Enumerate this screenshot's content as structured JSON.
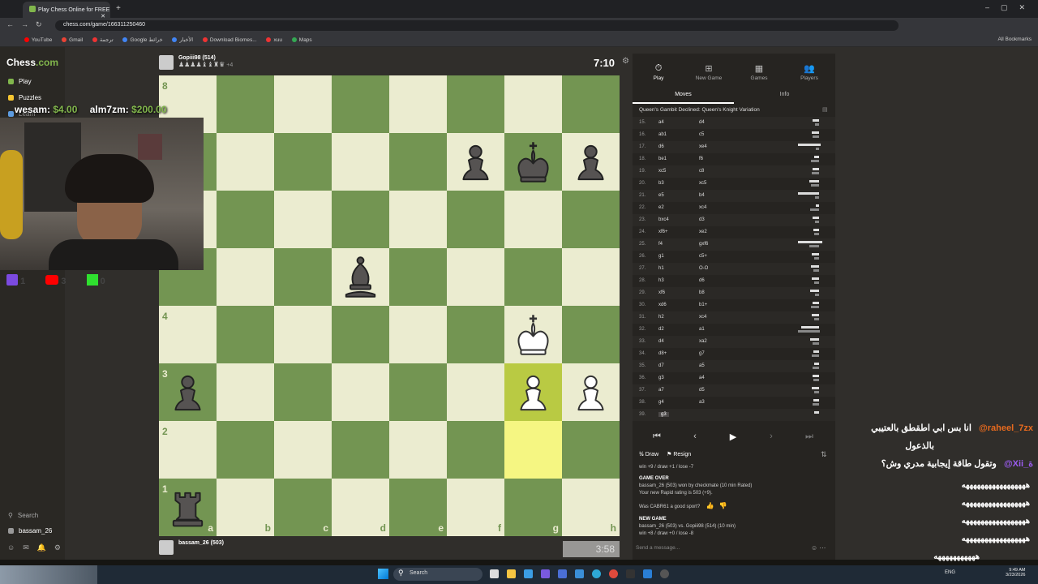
{
  "browser": {
    "tab_title": "Play Chess Online for FREE",
    "url": "chess.com/game/166311250460",
    "bookmarks": [
      "YouTube",
      "Gmail",
      "ترجمة",
      "Google خرائط",
      "الأخبار",
      "Download Biomes...",
      "xuu",
      "Maps"
    ],
    "all_bookmarks": "All Bookmarks"
  },
  "sidebar": {
    "logo_part1": "Chess",
    "logo_part2": ".com",
    "items": [
      "Play",
      "Puzzles",
      "Learn"
    ],
    "search": "Search",
    "user": "bassam_26"
  },
  "top_player": {
    "name": "Gopiii98 (514)",
    "captured": "♟♟♟♟♝♝♜♛",
    "adv": "+4",
    "clock": "7:10"
  },
  "bottom_player": {
    "name": "bassam_26 (503)",
    "clock": "3:58"
  },
  "board": {
    "ranks": [
      "8",
      "7",
      "6",
      "5",
      "4",
      "3",
      "2",
      "1"
    ],
    "files": [
      "a",
      "b",
      "c",
      "d",
      "e",
      "f",
      "g",
      "h"
    ],
    "pieces": [
      {
        "sq": "f7",
        "p": "bP"
      },
      {
        "sq": "g7",
        "p": "bK"
      },
      {
        "sq": "h7",
        "p": "bP"
      },
      {
        "sq": "d5",
        "p": "bB"
      },
      {
        "sq": "g4",
        "p": "wK"
      },
      {
        "sq": "a3",
        "p": "bP"
      },
      {
        "sq": "g3",
        "p": "wP"
      },
      {
        "sq": "h3",
        "p": "wP"
      },
      {
        "sq": "a1",
        "p": "bR"
      }
    ],
    "highlight": [
      "g3",
      "g2"
    ]
  },
  "panel": {
    "tabs": [
      "Play",
      "New Game",
      "Games",
      "Players"
    ],
    "subtabs": [
      "Moves",
      "Info"
    ],
    "opening": "Queen's Gambit Declined: Queen's Knight Variation",
    "moves": [
      {
        "n": "15.",
        "w": "a4",
        "b": "d4"
      },
      {
        "n": "16.",
        "w": "ab1",
        "b": "c5"
      },
      {
        "n": "17.",
        "w": "d6",
        "b": "xe4"
      },
      {
        "n": "18.",
        "w": "be1",
        "b": "f6"
      },
      {
        "n": "19.",
        "w": "xc5",
        "b": "c8"
      },
      {
        "n": "20.",
        "w": "b3",
        "b": "xc5"
      },
      {
        "n": "21.",
        "w": "e5",
        "b": "b4"
      },
      {
        "n": "22.",
        "w": "e2",
        "b": "xc4"
      },
      {
        "n": "23.",
        "w": "bxc4",
        "b": "d3"
      },
      {
        "n": "24.",
        "w": "xf6+",
        "b": "xe2"
      },
      {
        "n": "25.",
        "w": "f4",
        "b": "gxf6"
      },
      {
        "n": "26.",
        "w": "g1",
        "b": "c5+"
      },
      {
        "n": "27.",
        "w": "h1",
        "b": "O-O"
      },
      {
        "n": "28.",
        "w": "h3",
        "b": "d6"
      },
      {
        "n": "29.",
        "w": "xf6",
        "b": "b8"
      },
      {
        "n": "30.",
        "w": "xd6",
        "b": "b1+"
      },
      {
        "n": "31.",
        "w": "h2",
        "b": "xc4"
      },
      {
        "n": "32.",
        "w": "d2",
        "b": "a1"
      },
      {
        "n": "33.",
        "w": "d4",
        "b": "xa2"
      },
      {
        "n": "34.",
        "w": "d8+",
        "b": "g7"
      },
      {
        "n": "35.",
        "w": "d7",
        "b": "a5"
      },
      {
        "n": "36.",
        "w": "g3",
        "b": "a4"
      },
      {
        "n": "37.",
        "w": "a7",
        "b": "d5"
      },
      {
        "n": "38.",
        "w": "g4",
        "b": "a3"
      },
      {
        "n": "39.",
        "w": "g3",
        "b": ""
      }
    ],
    "draw": "Draw",
    "resign": "Resign",
    "record": "win +9 / draw +1 / lose -7",
    "game_over_title": "GAME OVER",
    "game_over_line1": "bassam_26 (503) won by checkmate (10 min Rated)",
    "game_over_line2": "Your new Rapid rating is 503 (+9).",
    "sport_q": "Was CABR61 a good sport?",
    "new_game_title": "NEW GAME",
    "new_game_line1": "bassam_26 (503) vs. Gopiii98 (514) (10 min)",
    "new_game_line2": "win +8 / draw +0 / lose -8",
    "send_placeholder": "Send a message..."
  },
  "overlay": {
    "donation1_name": "wesam:",
    "donation1_amt": "$4.00",
    "donation2_name": "alm7zm:",
    "donation2_amt": "$200.00",
    "social": [
      "1",
      "3",
      "0"
    ],
    "chat1_user": "@raheel_7zx",
    "chat1_text": "انا بس ابي اطقطق بالعتيبي",
    "chat1_text2": "بالذعول",
    "chat2_user": "@Xii_ة",
    "chat2_text": "وتقول طاقة إيجابية مدري وش؟",
    "chat_spam": [
      "هههههههههههههههههه",
      "هههههههههههههههههه",
      "هههههههههههههههههه",
      "هههههههههههههههههه",
      "هههههههههههه"
    ]
  },
  "taskbar": {
    "search": "Search",
    "lang": "ENG",
    "time": "9:49 AM",
    "date": "3/23/2026"
  }
}
